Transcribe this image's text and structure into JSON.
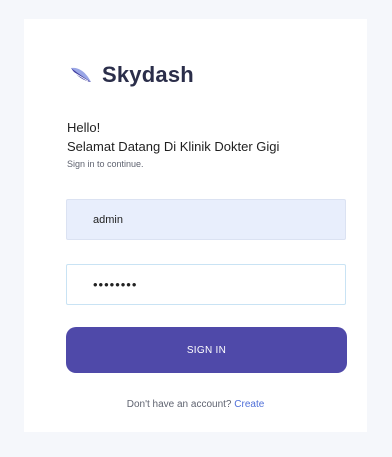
{
  "brand": {
    "name": "Skydash",
    "logo_icon": "feather-logo-icon",
    "logo_colors": [
      "#3f3d9f",
      "#9aa6e6"
    ]
  },
  "greeting": {
    "hello": "Hello!",
    "welcome": "Selamat Datang Di Klinik Dokter Gigi",
    "subtitle": "Sign in to continue."
  },
  "form": {
    "username_value": "admin",
    "password_value": "••••••••",
    "signin_label": "SIGN IN"
  },
  "footer": {
    "prompt": "Don't have an account?",
    "link_label": "Create"
  },
  "colors": {
    "accent": "#4f49a9",
    "link": "#4f6fd8",
    "input_fill": "#e8eefc"
  }
}
